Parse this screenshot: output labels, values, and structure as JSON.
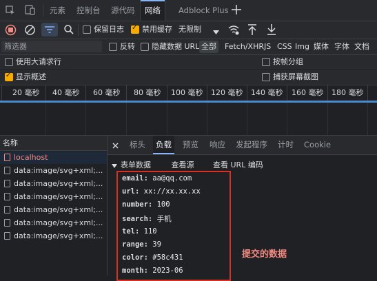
{
  "tabs": [
    "元素",
    "控制台",
    "源代码",
    "网络",
    "Adblock Plus"
  ],
  "toolbar": {
    "preserve_log": "保留日志",
    "disable_cache": "禁用缓存",
    "throttle": "无限制"
  },
  "filter": {
    "placeholder": "筛选器",
    "invert": "反转",
    "hide_data_urls": "隐藏数据 URL",
    "types": [
      "全部",
      "Fetch/XHR",
      "JS",
      "CSS",
      "Img",
      "媒体",
      "字体",
      "文档"
    ]
  },
  "options": {
    "large_rows": "使用大请求行",
    "group_by_frame": "按帧分组",
    "show_overview": "显示概述",
    "capture_screenshots": "捕获屏幕截图"
  },
  "timeline_ticks": [
    "20 毫秒",
    "40 毫秒",
    "60 毫秒",
    "80 毫秒",
    "100 毫秒",
    "120 毫秒",
    "140 毫秒",
    "160 毫秒",
    "180 毫秒"
  ],
  "list": {
    "header": "名称",
    "items": [
      "localhost",
      "data:image/svg+xml;...",
      "data:image/svg+xml;...",
      "data:image/svg+xml;...",
      "data:image/svg+xml;...",
      "data:image/svg+xml;...",
      "data:image/svg+xml;..."
    ]
  },
  "detail": {
    "tabs": [
      "标头",
      "负载",
      "预览",
      "响应",
      "发起程序",
      "计时",
      "Cookie"
    ],
    "form_section": "表单数据",
    "view_source": "查看源",
    "view_url_encoded": "查看 URL 编码",
    "fields": [
      {
        "key": "email:",
        "value": "aa@qq.com"
      },
      {
        "key": "url:",
        "value": "xx://xx.xx.xx"
      },
      {
        "key": "number:",
        "value": "100"
      },
      {
        "key": "search:",
        "value": "手机"
      },
      {
        "key": "tel:",
        "value": "110"
      },
      {
        "key": "range:",
        "value": "39"
      },
      {
        "key": "color:",
        "value": "#58c431"
      },
      {
        "key": "month:",
        "value": "2023-06"
      }
    ],
    "annotation": "提交的数据"
  },
  "colors": {
    "accent": "#8ab4f8",
    "record": "#f28b82",
    "checkbox": "#f9ab00",
    "highlight_box": "#d93025"
  }
}
